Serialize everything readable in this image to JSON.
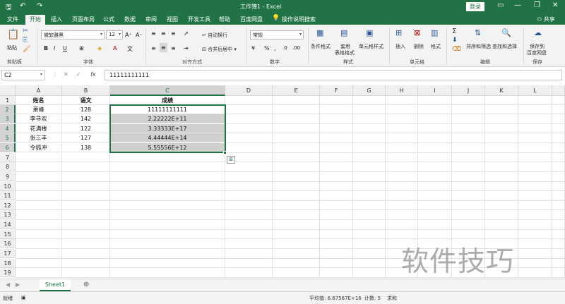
{
  "window": {
    "title": "工作簿1  -  Excel",
    "login_label": "登录",
    "minimize": "▭",
    "restore": "❐",
    "close": "✕"
  },
  "quick_access": {
    "save": "🖫",
    "undo": "↶",
    "redo": "↷"
  },
  "menu": {
    "tabs": [
      "文件",
      "开始",
      "插入",
      "页面布局",
      "公式",
      "数据",
      "审阅",
      "视图",
      "开发工具",
      "帮助",
      "百度网盘"
    ],
    "active_tab": "开始",
    "tell_me": "操作说明搜索",
    "share": "共享"
  },
  "ribbon": {
    "clipboard": {
      "paste": "粘贴",
      "label": "剪贴板"
    },
    "font": {
      "name": "微软雅黑",
      "size": "12",
      "label": "字体",
      "bold": "B",
      "italic": "I",
      "underline": "U",
      "grow": "A⁺",
      "shrink": "A⁻",
      "color": "A"
    },
    "alignment": {
      "wrap": "自动换行",
      "merge": "合并后居中",
      "label": "对齐方式"
    },
    "number": {
      "format": "常规",
      "label": "数字",
      "percent": "%",
      "comma": ","
    },
    "styles": {
      "conditional": "条件格式",
      "table_line1": "套用",
      "table_line2": "表格格式",
      "cell_styles": "单元格样式",
      "label": "样式"
    },
    "cells": {
      "insert": "插入",
      "delete": "删除",
      "format": "格式",
      "label": "单元格"
    },
    "editing": {
      "sort_filter": "排序和筛选",
      "find_select": "查找和选择",
      "label": "编辑"
    },
    "save_group": {
      "save_to_line1": "保存到",
      "save_to_line2": "百度网盘",
      "label": "保存"
    }
  },
  "formula_bar": {
    "name_box": "C2",
    "cancel": "✕",
    "enter": "✓",
    "fx": "fx",
    "value": "11111111111"
  },
  "columns": [
    "A",
    "B",
    "C",
    "D",
    "E",
    "F",
    "G",
    "H",
    "I",
    "J",
    "K",
    "L"
  ],
  "rows": [
    "1",
    "2",
    "3",
    "4",
    "5",
    "6",
    "7",
    "8",
    "9",
    "10",
    "11",
    "12",
    "13",
    "14",
    "15",
    "16",
    "17",
    "18",
    "19"
  ],
  "cells": [
    [
      "姓名",
      "语文",
      "成绩"
    ],
    [
      "萧峰",
      "128",
      "11111111111"
    ],
    [
      "李寻欢",
      "142",
      "2.22222E+11"
    ],
    [
      "花满楼",
      "122",
      "3.33333E+17"
    ],
    [
      "张三丰",
      "127",
      "4.44444E+14"
    ],
    [
      "令狐冲",
      "138",
      "5.55556E+12"
    ]
  ],
  "quick_analysis": "⊞",
  "watermark": "软件技巧",
  "sheet_tabs": {
    "active": "Sheet1",
    "add": "⊕"
  },
  "status": {
    "ready": "就绪",
    "average": "平均值: 6.67567E+16",
    "count": "计数: 5",
    "sum": "求和"
  }
}
